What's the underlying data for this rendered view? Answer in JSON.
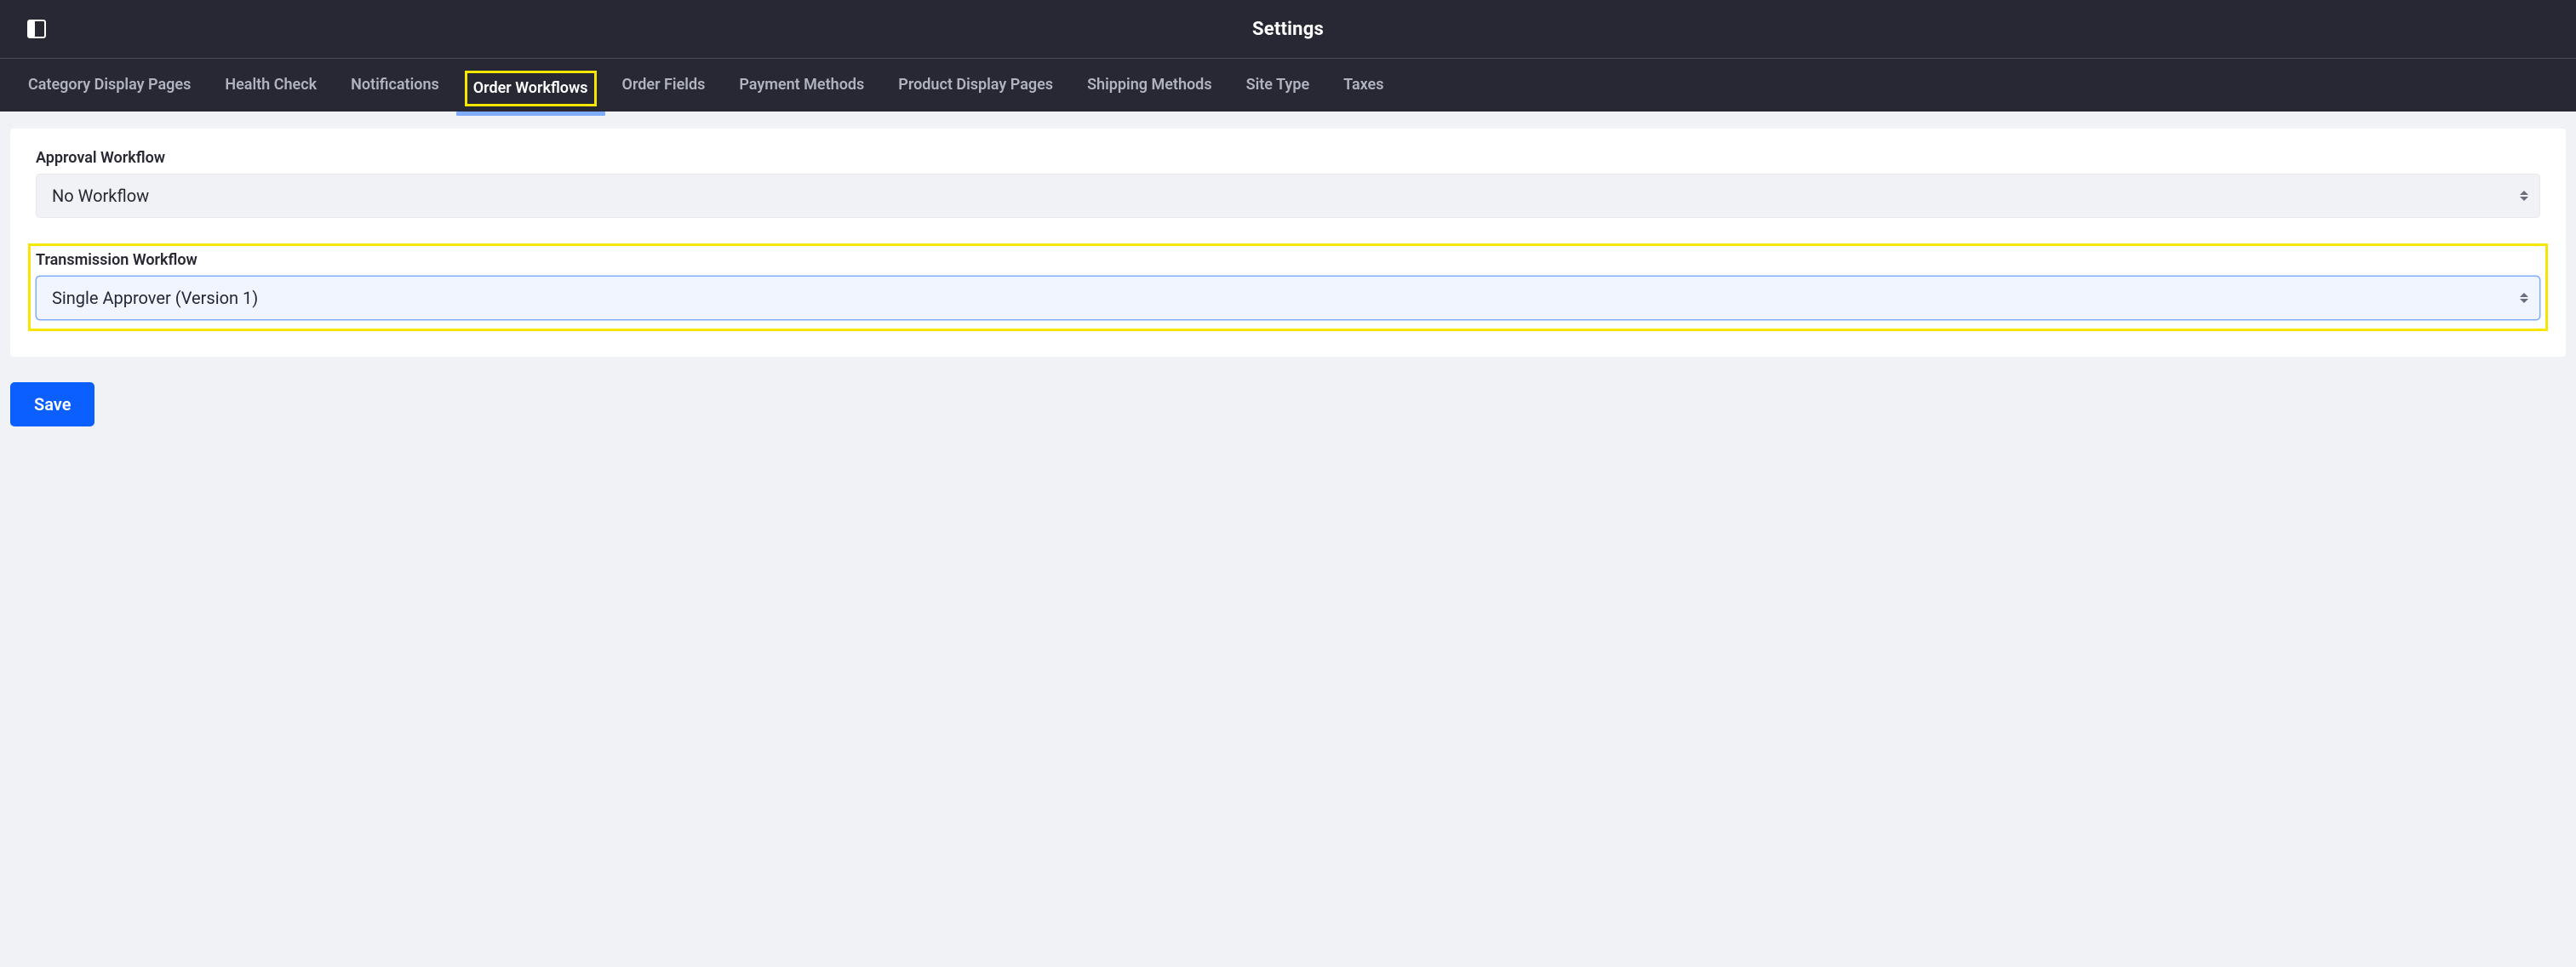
{
  "header": {
    "title": "Settings"
  },
  "tabs": [
    {
      "label": "Category Display Pages",
      "active": false
    },
    {
      "label": "Health Check",
      "active": false
    },
    {
      "label": "Notifications",
      "active": false
    },
    {
      "label": "Order Workflows",
      "active": true
    },
    {
      "label": "Order Fields",
      "active": false
    },
    {
      "label": "Payment Methods",
      "active": false
    },
    {
      "label": "Product Display Pages",
      "active": false
    },
    {
      "label": "Shipping Methods",
      "active": false
    },
    {
      "label": "Site Type",
      "active": false
    },
    {
      "label": "Taxes",
      "active": false
    }
  ],
  "form": {
    "approval_workflow": {
      "label": "Approval Workflow",
      "value": "No Workflow"
    },
    "transmission_workflow": {
      "label": "Transmission Workflow",
      "value": "Single Approver (Version 1)"
    }
  },
  "actions": {
    "save_label": "Save"
  }
}
